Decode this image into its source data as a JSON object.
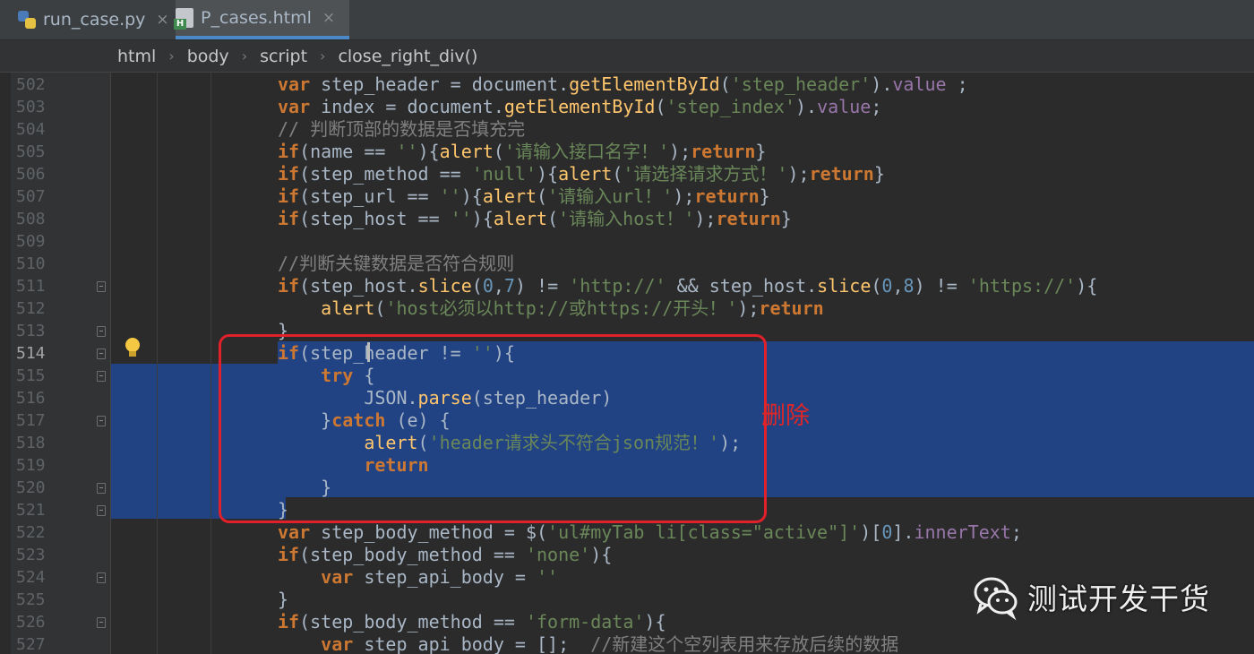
{
  "tabs": [
    {
      "label": "run_case.py",
      "icon": "python-file-icon",
      "close": "×"
    },
    {
      "label": "P_cases.html",
      "icon": "html-file-icon",
      "close": "×"
    }
  ],
  "breadcrumb": [
    "html",
    "body",
    "script",
    "close_right_div()"
  ],
  "breadcrumb_sep": "›",
  "line_numbers": [
    "502",
    "503",
    "504",
    "505",
    "506",
    "507",
    "508",
    "509",
    "510",
    "511",
    "512",
    "513",
    "514",
    "515",
    "516",
    "517",
    "518",
    "519",
    "520",
    "521",
    "522",
    "523",
    "524",
    "525",
    "526",
    "527"
  ],
  "annotation": "删除",
  "watermark": {
    "text": "测试开发干货",
    "icon": "wechat-icon"
  },
  "colors": {
    "selection": "#214283",
    "annotation": "#e0202a",
    "keyword": "#cc7832",
    "string": "#6a8759",
    "function": "#ffc66d"
  },
  "code": {
    "l502": [
      [
        "k",
        "var"
      ],
      [
        "t",
        " step_header = document."
      ],
      [
        "f",
        "getElementById"
      ],
      [
        "t",
        "("
      ],
      [
        "s",
        "'step_header'"
      ],
      [
        "t",
        ")."
      ],
      [
        "p",
        "value"
      ],
      [
        "t",
        " ;"
      ]
    ],
    "l503": [
      [
        "k",
        "var"
      ],
      [
        "t",
        " index = document."
      ],
      [
        "f",
        "getElementById"
      ],
      [
        "t",
        "("
      ],
      [
        "s",
        "'step_index'"
      ],
      [
        "t",
        ")."
      ],
      [
        "p",
        "value"
      ],
      [
        "t",
        ";"
      ]
    ],
    "l504": [
      [
        "c",
        "// 判断顶部的数据是否填充完"
      ]
    ],
    "l505": [
      [
        "k",
        "if"
      ],
      [
        "t",
        "("
      ],
      [
        "t",
        "name"
      ],
      [
        "t",
        " == "
      ],
      [
        "s",
        "''"
      ],
      [
        "t",
        "){"
      ],
      [
        "f",
        "alert"
      ],
      [
        "t",
        "("
      ],
      [
        "s",
        "'请输入接口名字！'"
      ],
      [
        "t",
        ");"
      ],
      [
        "k",
        "return"
      ],
      [
        "t",
        "}"
      ]
    ],
    "l506": [
      [
        "k",
        "if"
      ],
      [
        "t",
        "("
      ],
      [
        "t",
        "step_method"
      ],
      [
        "t",
        " == "
      ],
      [
        "s",
        "'null'"
      ],
      [
        "t",
        "){"
      ],
      [
        "f",
        "alert"
      ],
      [
        "t",
        "("
      ],
      [
        "s",
        "'请选择请求方式！'"
      ],
      [
        "t",
        ");"
      ],
      [
        "k",
        "return"
      ],
      [
        "t",
        "}"
      ]
    ],
    "l507": [
      [
        "k",
        "if"
      ],
      [
        "t",
        "("
      ],
      [
        "t",
        "step_url"
      ],
      [
        "t",
        " == "
      ],
      [
        "s",
        "''"
      ],
      [
        "t",
        "){"
      ],
      [
        "f",
        "alert"
      ],
      [
        "t",
        "("
      ],
      [
        "s",
        "'请输入url！'"
      ],
      [
        "t",
        ");"
      ],
      [
        "k",
        "return"
      ],
      [
        "t",
        "}"
      ]
    ],
    "l508": [
      [
        "k",
        "if"
      ],
      [
        "t",
        "("
      ],
      [
        "t",
        "step_host"
      ],
      [
        "t",
        " == "
      ],
      [
        "s",
        "''"
      ],
      [
        "t",
        "){"
      ],
      [
        "f",
        "alert"
      ],
      [
        "t",
        "("
      ],
      [
        "s",
        "'请输入host！'"
      ],
      [
        "t",
        ");"
      ],
      [
        "k",
        "return"
      ],
      [
        "t",
        "}"
      ]
    ],
    "l509": [],
    "l510": [
      [
        "c",
        "//判断关键数据是否符合规则"
      ]
    ],
    "l511": [
      [
        "k",
        "if"
      ],
      [
        "t",
        "("
      ],
      [
        "t",
        "step_host."
      ],
      [
        "f",
        "slice"
      ],
      [
        "t",
        "("
      ],
      [
        "n",
        "0"
      ],
      [
        "t",
        ","
      ],
      [
        "n",
        "7"
      ],
      [
        "t",
        ")"
      ],
      [
        "t",
        " != "
      ],
      [
        "s",
        "'http://'"
      ],
      [
        "t",
        " && "
      ],
      [
        "t",
        "step_host."
      ],
      [
        "f",
        "slice"
      ],
      [
        "t",
        "("
      ],
      [
        "n",
        "0"
      ],
      [
        "t",
        ","
      ],
      [
        "n",
        "8"
      ],
      [
        "t",
        ")"
      ],
      [
        "t",
        " != "
      ],
      [
        "s",
        "'https://'"
      ],
      [
        "t",
        "){"
      ]
    ],
    "l512": [
      [
        "t",
        "    "
      ],
      [
        "f",
        "alert"
      ],
      [
        "t",
        "("
      ],
      [
        "s",
        "'host必须以http://或https://开头！'"
      ],
      [
        "t",
        ");"
      ],
      [
        "k",
        "return"
      ]
    ],
    "l513": [
      [
        "t",
        "}"
      ]
    ],
    "l514": [
      [
        "k",
        "if"
      ],
      [
        "t",
        "(step_header != "
      ],
      [
        "s",
        "''"
      ],
      [
        "t",
        "){"
      ]
    ],
    "l515": [
      [
        "t",
        "    "
      ],
      [
        "k",
        "try"
      ],
      [
        "t",
        " {"
      ]
    ],
    "l516": [
      [
        "t",
        "        JSON."
      ],
      [
        "f",
        "parse"
      ],
      [
        "t",
        "(step_header)"
      ]
    ],
    "l517": [
      [
        "t",
        "    }"
      ],
      [
        "k",
        "catch"
      ],
      [
        "t",
        " (e) {"
      ]
    ],
    "l518": [
      [
        "t",
        "        "
      ],
      [
        "f",
        "alert"
      ],
      [
        "t",
        "("
      ],
      [
        "s",
        "'header请求头不符合json规范！'"
      ],
      [
        "t",
        ");"
      ]
    ],
    "l519": [
      [
        "t",
        "        "
      ],
      [
        "k",
        "return"
      ]
    ],
    "l520": [
      [
        "t",
        "    }"
      ]
    ],
    "l521": [
      [
        "t",
        "}"
      ]
    ],
    "l522": [
      [
        "k",
        "var"
      ],
      [
        "t",
        " step_body_method = $("
      ],
      [
        "s",
        "'ul#myTab li[class=\"active\"]'"
      ],
      [
        "t",
        ")["
      ],
      [
        "n",
        "0"
      ],
      [
        "t",
        "]."
      ],
      [
        "p",
        "innerText"
      ],
      [
        "t",
        ";"
      ]
    ],
    "l523": [
      [
        "k",
        "if"
      ],
      [
        "t",
        "("
      ],
      [
        "t",
        "step_body_method"
      ],
      [
        "t",
        " == "
      ],
      [
        "s",
        "'none'"
      ],
      [
        "t",
        "){"
      ]
    ],
    "l524": [
      [
        "t",
        "    "
      ],
      [
        "k",
        "var"
      ],
      [
        "t",
        " "
      ],
      [
        "t",
        "step_api_body"
      ],
      [
        "t",
        " = "
      ],
      [
        "s",
        "''"
      ]
    ],
    "l525": [
      [
        "t",
        "}"
      ]
    ],
    "l526": [
      [
        "k",
        "if"
      ],
      [
        "t",
        "("
      ],
      [
        "t",
        "step_body_method"
      ],
      [
        "t",
        " == "
      ],
      [
        "s",
        "'form-data'"
      ],
      [
        "t",
        "){"
      ]
    ],
    "l527": [
      [
        "t",
        "    "
      ],
      [
        "k",
        "var"
      ],
      [
        "t",
        " "
      ],
      [
        "t",
        "step_api_body"
      ],
      [
        "t",
        " = [];  "
      ],
      [
        "c",
        "//新建这个空列表用来存放后续的数据"
      ]
    ]
  }
}
